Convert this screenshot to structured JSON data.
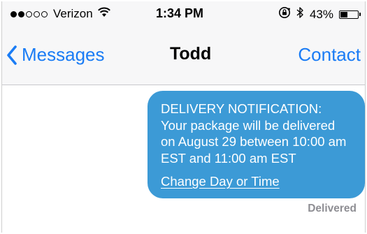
{
  "status_bar": {
    "signal": {
      "filled": 2,
      "total": 5
    },
    "carrier": "Verizon",
    "wifi_icon": "wifi-icon",
    "time": "1:34 PM",
    "rotation_lock_icon": "rotation-lock-icon",
    "bluetooth_icon": "bluetooth-icon",
    "battery_percent_label": "43%",
    "battery_level": 0.43
  },
  "nav": {
    "back_label": "Messages",
    "back_icon": "chevron-left-icon",
    "title": "Todd",
    "contact_label": "Contact"
  },
  "message": {
    "lines": [
      "DELIVERY NOTIFICATION:",
      "Your package will be delivered",
      "on August 29 between 10:00 am",
      "EST and 11:00 am EST"
    ],
    "link_text": "Change Day or Time",
    "status": "Delivered"
  },
  "colors": {
    "accent": "#1a7cf5",
    "bubble": "#3c9ad6",
    "delivered_text": "#8e8e93",
    "bar_background": "#f7f7f8"
  }
}
